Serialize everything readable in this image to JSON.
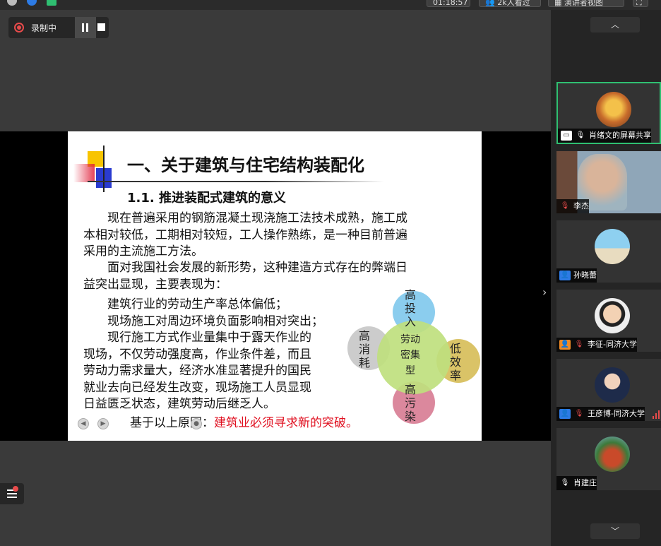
{
  "top_bar": {
    "timer": "01:18:57",
    "viewers": "2k人看过",
    "view_mode": "演讲者视图"
  },
  "recording": {
    "label": "录制中"
  },
  "slide": {
    "title": "一、关于建筑与住宅结构装配化",
    "subtitle": "1.1. 推进装配式建筑的意义",
    "p1": [
      "　　现在普遍采用的钢筋混凝土现浇施工法技术成熟，施工成",
      "本相对较低，工期相对较短，工人操作熟练，是一种目前普遍",
      "采用的主流施工方法。"
    ],
    "p2": [
      "　　面对我国社会发展的新形势，这种建造方式存在的弊端日",
      "益突出显现，主要表现为："
    ],
    "p3": [
      "　　建筑行业的劳动生产率总体偏低；",
      "　　现场施工对周边环境负面影响相对突出；"
    ],
    "p4": [
      "　　现行施工方式作业量集中于露天作业的",
      "现场，不仅劳动强度高，作业条件差，而且",
      "劳动力需求量大，经济水准显著提升的国民",
      "就业去向已经发生改变，现场施工人员显现",
      "日益匮乏状态，建筑劳动后继乏人。"
    ],
    "conclusion_prefix": "基于以上原因：",
    "conclusion_highlight": "建筑业必须寻求新的突破。",
    "diagram": {
      "center": [
        "劳动",
        "密集",
        "型"
      ],
      "top": [
        "高",
        "投",
        "入"
      ],
      "left": [
        "高",
        "消",
        "耗"
      ],
      "right": [
        "低",
        "效",
        "率"
      ],
      "bottom": [
        "高",
        "污",
        "染"
      ]
    }
  },
  "participants": [
    {
      "name": "肖绪文的屏幕共享",
      "active": true
    },
    {
      "name": "李杰"
    },
    {
      "name": "孙晓蕾"
    },
    {
      "name": "李征-同济大学"
    },
    {
      "name": "王彦博-同济大学"
    },
    {
      "name": "肖建庄"
    }
  ],
  "colors": {
    "accent_green": "#2fbf71",
    "record_red": "#e84b4b",
    "highlight_red": "#e01020"
  }
}
